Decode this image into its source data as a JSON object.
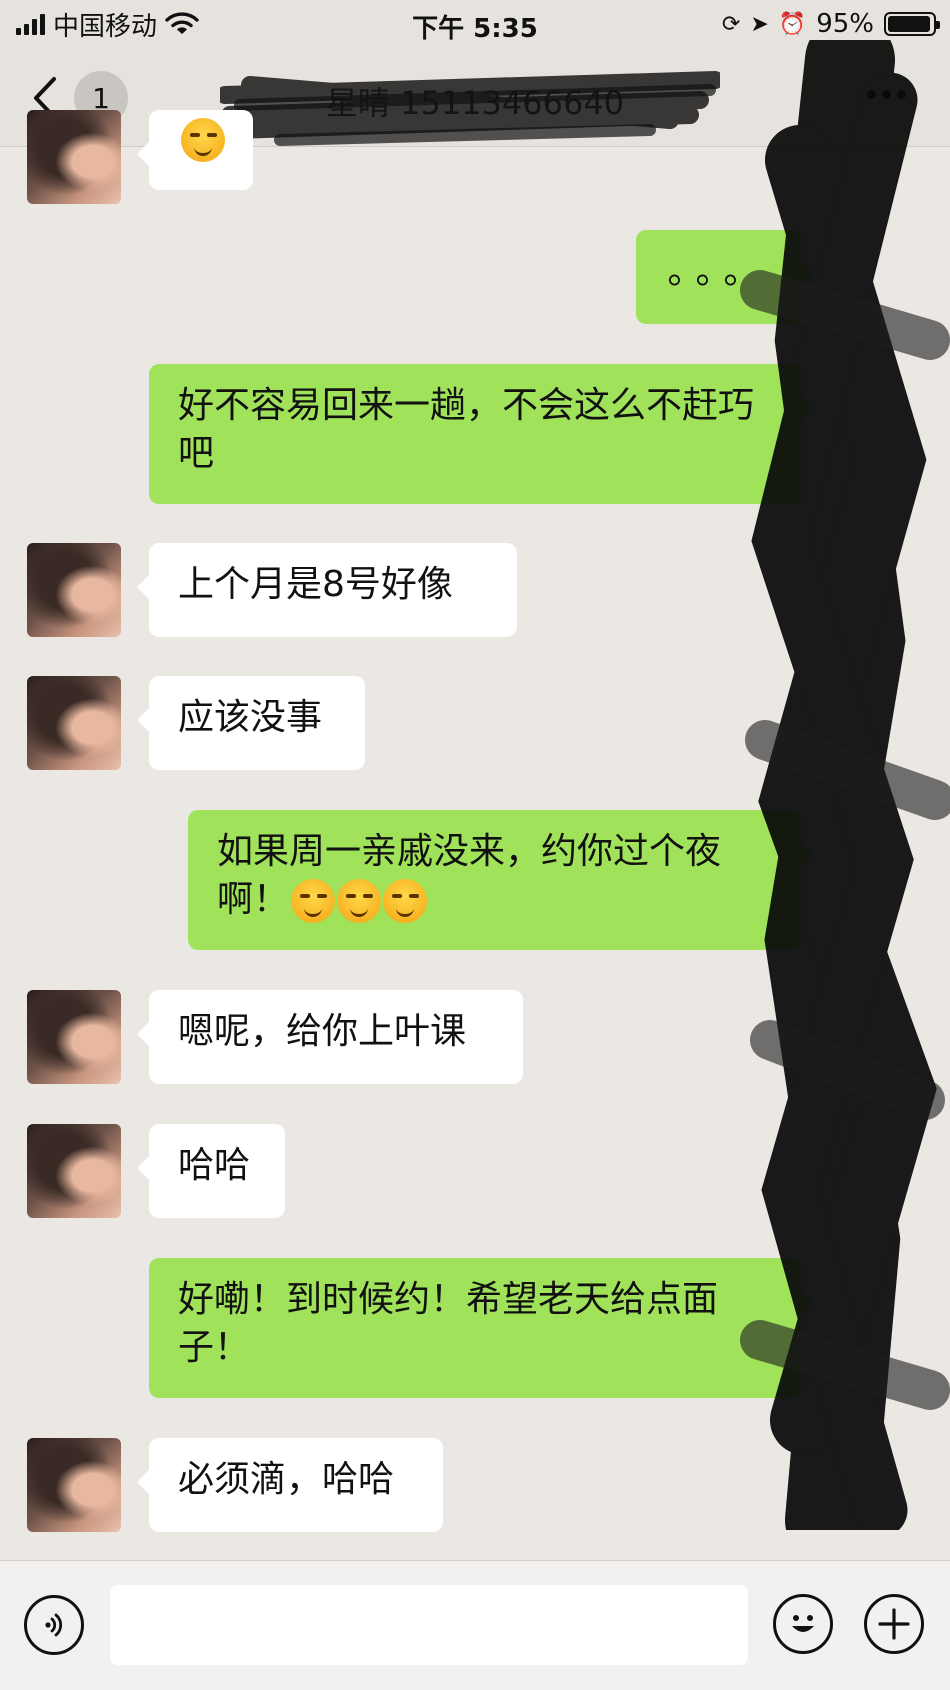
{
  "status_bar": {
    "carrier": "中国移动",
    "time": "下午 5:35",
    "battery": "95%"
  },
  "nav": {
    "back_badge": "1",
    "title": "星晴 15113466640"
  },
  "messages": [
    {
      "side": "right",
      "text": "。。。"
    },
    {
      "side": "right",
      "text": "好不容易回来一趟，不会这么不赶巧吧"
    },
    {
      "side": "left",
      "text": "上个月是8号好像"
    },
    {
      "side": "left",
      "text": "应该没事"
    },
    {
      "side": "right",
      "text": "如果周一亲戚没来，约你过个夜啊！",
      "emoji": [
        "smiling-face",
        "smiling-face",
        "smiling-face"
      ]
    },
    {
      "side": "left",
      "text": "嗯呢，给你上叶课"
    },
    {
      "side": "left",
      "text": "哈哈"
    },
    {
      "side": "right",
      "text": "好嘞！到时候约！希望老天给点面子！"
    },
    {
      "side": "left",
      "text": "必须滴，哈哈"
    }
  ],
  "colors": {
    "sent_bubble": "#a0e35a",
    "received_bubble": "#ffffff",
    "background": "#ebe8e4"
  },
  "icons": [
    "back-chevron-icon",
    "more-icon",
    "voice-icon",
    "emoji-icon",
    "plus-icon"
  ]
}
